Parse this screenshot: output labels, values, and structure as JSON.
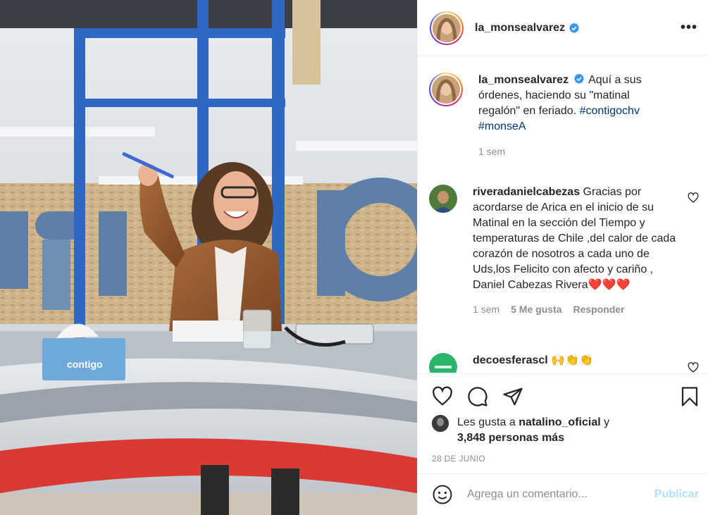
{
  "post": {
    "username": "la_monsealvarez",
    "more_icon": "more-horizontal-icon",
    "caption": {
      "username": "la_monsealvarez",
      "text": "Aquí a sus órdenes, haciendo su \"matinal regalón\" en feriado.",
      "hashtag1": "#contigochv",
      "hashtag2": "#monseA",
      "time": "1 sem"
    },
    "comments": [
      {
        "username": "riveradanielcabezas",
        "text": "Gracias por acordarse de Arica en el inicio de su Matinal en la sección del Tiempo y temperaturas de Chile ,del calor de cada corazón de nosotros a cada uno de Uds,los Felicito con afecto y cariño , Daniel Cabezas Rivera",
        "emojis": "❤️❤️❤️",
        "time": "1 sem",
        "likes": "5 Me gusta",
        "reply": "Responder"
      },
      {
        "username": "decoesferascl",
        "emojis": "🙌👏👏"
      }
    ],
    "liked_by": {
      "prefix": "Les gusta a",
      "user": "natalino_oficial",
      "joiner": "y",
      "others": "3,848 personas más"
    },
    "date": "28 DE JUNIO",
    "comment_box": {
      "placeholder": "Agrega un comentario...",
      "publish": "Publicar"
    },
    "photo": {
      "box_brand": "contigo"
    }
  },
  "colors": {
    "link": "#00376b",
    "secondary": "#8e8e8e",
    "border": "#efefef",
    "publish_disabled": "#b2dffc",
    "verified": "#3897f0",
    "heart_red": "#ed4956"
  }
}
